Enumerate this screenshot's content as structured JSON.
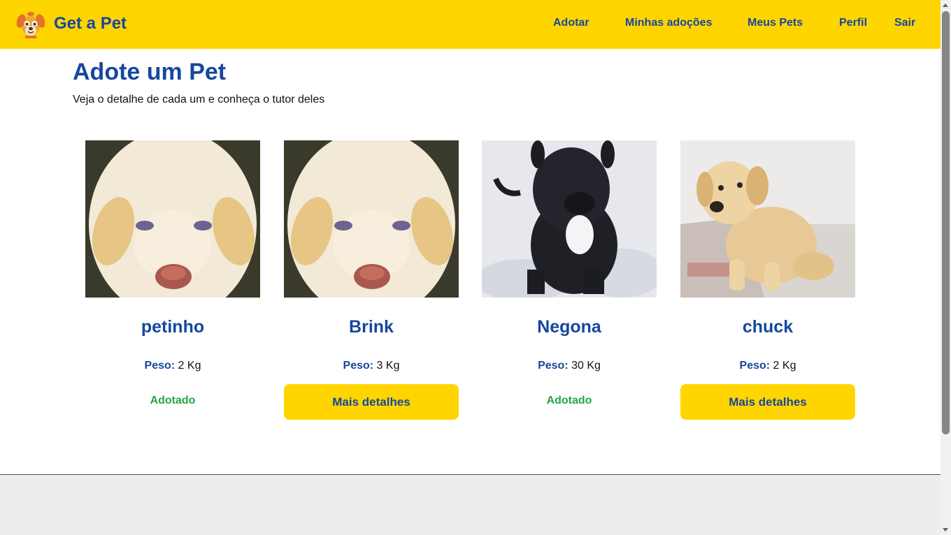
{
  "header": {
    "brand_title": "Get a Pet",
    "logo_icon": "dog-face-icon",
    "nav": {
      "adopt": "Adotar",
      "my_adoptions": "Minhas adoções",
      "my_pets": "Meus Pets",
      "profile": "Perfil",
      "logout": "Sair"
    }
  },
  "main": {
    "title": "Adote um Pet",
    "subtitle": "Veja o detalhe de cada um e conheça o tutor deles",
    "weight_label": "Peso:",
    "details_label": "Mais detalhes",
    "adopted_label": "Adotado",
    "pets": [
      {
        "name": "petinho",
        "weight": "2 Kg",
        "status": "adopted",
        "photo": "cream-puppy-face-photo"
      },
      {
        "name": "Brink",
        "weight": "3 Kg",
        "status": "available",
        "photo": "cream-puppy-face-photo"
      },
      {
        "name": "Negona",
        "weight": "30 Kg",
        "status": "adopted",
        "photo": "black-dog-in-snow-photo"
      },
      {
        "name": "chuck",
        "weight": "2 Kg",
        "status": "available",
        "photo": "yellow-lab-puppy-sitting-photo"
      }
    ]
  },
  "colors": {
    "brand_yellow": "#FFD500",
    "brand_blue": "#16479D",
    "adopted_green": "#25A547",
    "footer_gray": "#EDEDED"
  }
}
